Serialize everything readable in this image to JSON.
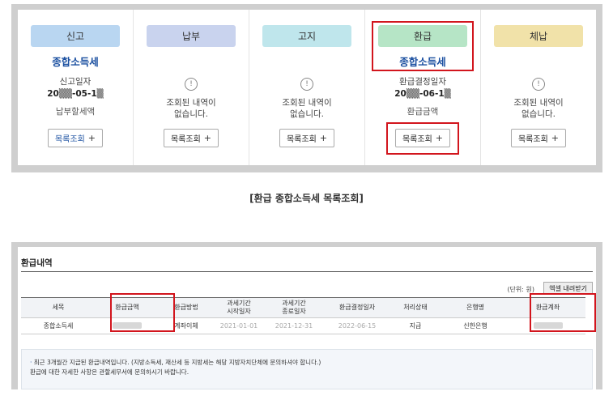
{
  "top_panel": {
    "columns": [
      {
        "key": "report",
        "header": "신고",
        "header_color": "#b9d6f1",
        "subtitle": "종합소득세",
        "has_icon": false,
        "line1": "신고일자",
        "date": "20▒▒-05-1▒",
        "line2": "납부할세액",
        "button": "목록조회",
        "button_blue": true
      },
      {
        "key": "payment",
        "header": "납부",
        "header_color": "#c9d3ee",
        "subtitle": "",
        "has_icon": true,
        "icon": "!",
        "message": "조회된 내역이\n없습니다.",
        "button": "목록조회"
      },
      {
        "key": "notice",
        "header": "고지",
        "header_color": "#bfe6ec",
        "subtitle": "",
        "has_icon": true,
        "icon": "!",
        "message": "조회된 내역이\n없습니다.",
        "button": "목록조회"
      },
      {
        "key": "refund",
        "header": "환급",
        "header_color": "#b6e5c6",
        "subtitle": "종합소득세",
        "has_icon": false,
        "line1": "환급결정일자",
        "date": "20▒▒-06-1▒",
        "line2": "환급금액",
        "button": "목록조회"
      },
      {
        "key": "arrears",
        "header": "체납",
        "header_color": "#f1e2a9",
        "subtitle": "",
        "has_icon": true,
        "icon": "!",
        "message": "조회된 내역이\n없습니다.",
        "button": "목록조회"
      }
    ],
    "plus": "+"
  },
  "caption": "[환급 종합소득세 목록조회]",
  "refund_section": {
    "title": "환급내역",
    "unit": "(단위: 원)",
    "excel_button": "엑셀 내려받기",
    "headers": [
      "세목",
      "환급금액",
      "환급방법",
      "과세기간\n시작일자",
      "과세기간\n종료일자",
      "환급결정일자",
      "처리상태",
      "은행명",
      "환급계좌"
    ],
    "row": {
      "tax_item": "종합소득세",
      "method": "계좌이체",
      "start": "2021-01-01",
      "end": "2021-12-31",
      "decision_date": "2022-06-15",
      "status": "지급",
      "bank": "신한은행"
    },
    "notice_line1": "최근 3개월간 지급된 환급내역입니다. (지방소득세, 재산세 등 지방세는 해당 지방자치단체에 문의하셔야 합니다.)",
    "notice_line2": "환급에 대한 자세한 사항은 관할세무서에 문의하시기 바랍니다.",
    "bullet": "·"
  },
  "colors": {
    "highlight": "#d2151d",
    "link_blue": "#1a4fa0"
  }
}
